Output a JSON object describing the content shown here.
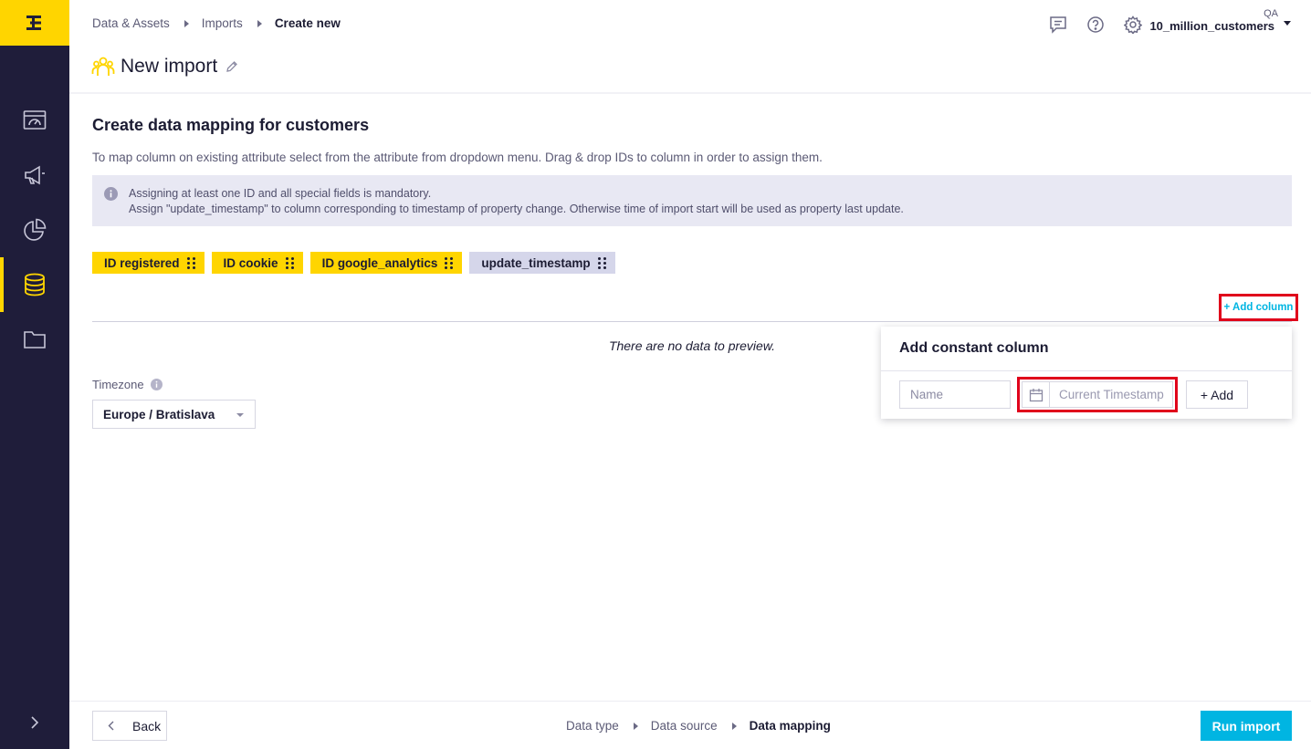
{
  "sidebar": {
    "logo": "E",
    "items": [
      {
        "name": "dashboard-icon",
        "active": false
      },
      {
        "name": "campaigns-icon",
        "active": false
      },
      {
        "name": "analyses-icon",
        "active": false
      },
      {
        "name": "data-assets-icon",
        "active": true
      },
      {
        "name": "files-icon",
        "active": false
      }
    ],
    "expand_icon": "chevron-right-icon"
  },
  "breadcrumb": {
    "items": [
      "Data & Assets",
      "Imports"
    ],
    "current": "Create new"
  },
  "header": {
    "icons": [
      "chat-icon",
      "help-icon",
      "gear-icon"
    ],
    "org": "QA",
    "project": "10_million_customers"
  },
  "page": {
    "title": "New import",
    "title_icon": "customers-icon",
    "edit_icon": "pencil-icon"
  },
  "mapping": {
    "title": "Create data mapping for customers",
    "description": "To map column on existing attribute select from the attribute from dropdown menu. Drag & drop IDs to column in order to assign them.",
    "info_lines": [
      "Assigning at least one ID and all special fields is mandatory.",
      "Assign \"update_timestamp\" to column corresponding to timestamp of property change. Otherwise time of import start will be used as property last update."
    ],
    "chips": [
      {
        "label": "ID registered"
      },
      {
        "label": "ID cookie"
      },
      {
        "label": "ID google_analytics"
      },
      {
        "label": "update_timestamp"
      }
    ],
    "add_column_label": "+ Add column",
    "empty_text": "There are no data to preview."
  },
  "timezone": {
    "label": "Timezone",
    "value": "Europe / Bratislava"
  },
  "popover": {
    "title": "Add constant column",
    "name_placeholder": "Name",
    "timestamp_placeholder": "Current Timestamp",
    "add_label": "+ Add"
  },
  "footer": {
    "back_label": "Back",
    "steps": [
      "Data type",
      "Data source"
    ],
    "current_step": "Data mapping",
    "run_label": "Run import"
  },
  "colors": {
    "sidebar": "#1f1d3a",
    "brand_yellow": "#ffd500",
    "accent_cyan": "#00b5e2",
    "highlight_red": "#e0001b",
    "chip_alt": "#d5d6ea",
    "info_bg": "#e8e8f3"
  }
}
